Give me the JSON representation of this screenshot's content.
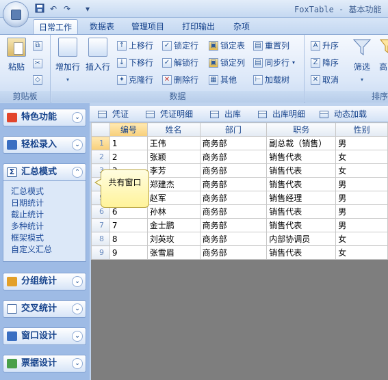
{
  "app": {
    "title": "FoxTable - 基本功能"
  },
  "qat": {
    "save_icon": "save-icon",
    "undo": "↶",
    "redo": "↷",
    "menu": "▾"
  },
  "tabs": [
    {
      "label": "日常工作",
      "active": true
    },
    {
      "label": "数据表",
      "active": false
    },
    {
      "label": "管理项目",
      "active": false
    },
    {
      "label": "打印输出",
      "active": false
    },
    {
      "label": "杂项",
      "active": false
    }
  ],
  "ribbon": {
    "clipboard": {
      "group_label": "剪贴板",
      "paste": "粘贴"
    },
    "data": {
      "group_label": "数据",
      "add_row": "增加行",
      "insert_row": "插入行",
      "move_up": "上移行",
      "move_down": "下移行",
      "clone_row": "克隆行",
      "lock_row": "锁定行",
      "unlock_row": "解锁行",
      "delete_row": "删除行",
      "lock_table": "锁定表",
      "lock_column": "锁定列",
      "other": "其他",
      "reset_column": "重置列",
      "sync_row": "同步行",
      "load_tree": "加载树"
    },
    "sort": {
      "group_label": "排序",
      "ascending": "升序",
      "descending": "降序",
      "cancel": "取消",
      "filter": "筛选",
      "advanced": "高"
    }
  },
  "sidebar": {
    "sections": [
      {
        "label": "特色功能",
        "expanded": false
      },
      {
        "label": "轻松录入",
        "expanded": false
      },
      {
        "label": "汇总模式",
        "expanded": true
      },
      {
        "label": "分组统计",
        "expanded": false
      },
      {
        "label": "交叉统计",
        "expanded": false
      },
      {
        "label": "窗口设计",
        "expanded": false
      },
      {
        "label": "票据设计",
        "expanded": false
      }
    ],
    "items": [
      "汇总模式",
      "日期统计",
      "截止统计",
      "多种统计",
      "框架模式",
      "自定义汇总"
    ]
  },
  "subtabs": [
    "凭证",
    "凭证明细",
    "出库",
    "出库明细",
    "动态加载"
  ],
  "grid": {
    "columns": [
      "编号",
      "姓名",
      "部门",
      "职务",
      "性别"
    ],
    "rows": [
      [
        "1",
        "1",
        "王伟",
        "商务部",
        "副总裁（销售）",
        "男"
      ],
      [
        "2",
        "2",
        "张颖",
        "商务部",
        "销售代表",
        "女"
      ],
      [
        "3",
        "3",
        "李芳",
        "商务部",
        "销售代表",
        "女"
      ],
      [
        "4",
        "4",
        "郑建杰",
        "商务部",
        "销售代表",
        "男"
      ],
      [
        "5",
        "5",
        "赵军",
        "商务部",
        "销售经理",
        "男"
      ],
      [
        "6",
        "6",
        "孙林",
        "商务部",
        "销售代表",
        "男"
      ],
      [
        "7",
        "7",
        "金士鹏",
        "商务部",
        "销售代表",
        "男"
      ],
      [
        "8",
        "8",
        "刘英玫",
        "商务部",
        "内部协调员",
        "女"
      ],
      [
        "9",
        "9",
        "张雪眉",
        "商务部",
        "销售代表",
        "女"
      ]
    ]
  },
  "tooltip": {
    "text": "共有窗口"
  },
  "colors": {
    "accent": "#15428b",
    "ribbon_bg": "#dbe7f8",
    "sidebar_bg": "#9ebbe5",
    "grid_empty": "#7e7e7e",
    "callout": "#fff39a"
  }
}
